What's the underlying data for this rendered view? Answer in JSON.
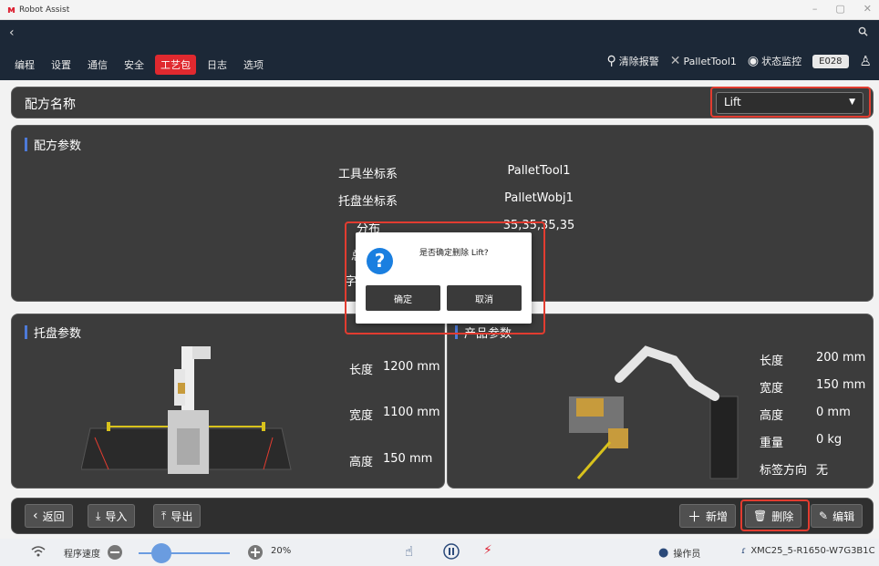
{
  "window": {
    "title": "Robot Assist",
    "controls": [
      "–",
      "▢",
      "✕"
    ]
  },
  "menu": [
    "编程",
    "设置",
    "通信",
    "安全",
    "工艺包",
    "日志",
    "选项"
  ],
  "menu_active": 4,
  "header_right": {
    "clear_alarm": "清除报警",
    "tool": "PalletTool1",
    "monitor": "状态监控",
    "error_code": "E028"
  },
  "recipe": {
    "label": "配方名称",
    "selected": "Lift"
  },
  "recipe_params": {
    "title": "配方参数",
    "rows": [
      {
        "key": "工具坐标系",
        "value": "PalletTool1"
      },
      {
        "key": "托盘坐标系",
        "value": "PalletWobj1"
      },
      {
        "key": "分布",
        "value": "35,35,35,35"
      }
    ],
    "hidden_keys": [
      "总",
      "字"
    ]
  },
  "pallet": {
    "title": "托盘参数",
    "length": {
      "key": "长度",
      "value": "1200 mm"
    },
    "width": {
      "key": "宽度",
      "value": "1100 mm"
    },
    "height": {
      "key": "高度",
      "value": "150 mm"
    }
  },
  "product": {
    "title": "产品参数",
    "rows": [
      {
        "key": "长度",
        "value": "200 mm"
      },
      {
        "key": "宽度",
        "value": "150 mm"
      },
      {
        "key": "高度",
        "value": "0 mm"
      },
      {
        "key": "重量",
        "value": "0 kg"
      },
      {
        "key": "标签方向",
        "value": "无"
      }
    ]
  },
  "toolbar": {
    "back": "返回",
    "import": "导入",
    "export": "导出",
    "add": "新增",
    "delete": "删除",
    "edit": "编辑"
  },
  "dialog": {
    "message": "是否确定删除 Lift?",
    "ok": "确定",
    "cancel": "取消"
  },
  "status": {
    "speed_label": "程序速度",
    "speed": "20%",
    "speed_fraction": 0.2,
    "user": "操作员",
    "controller": "XMC25_5-R1650-W7G3B1C"
  },
  "colors": {
    "accent_red": "#e0292f",
    "header_bg": "#1c2837",
    "panel_bg": "#3c3c3c",
    "info_blue": "#1a7fe0"
  }
}
